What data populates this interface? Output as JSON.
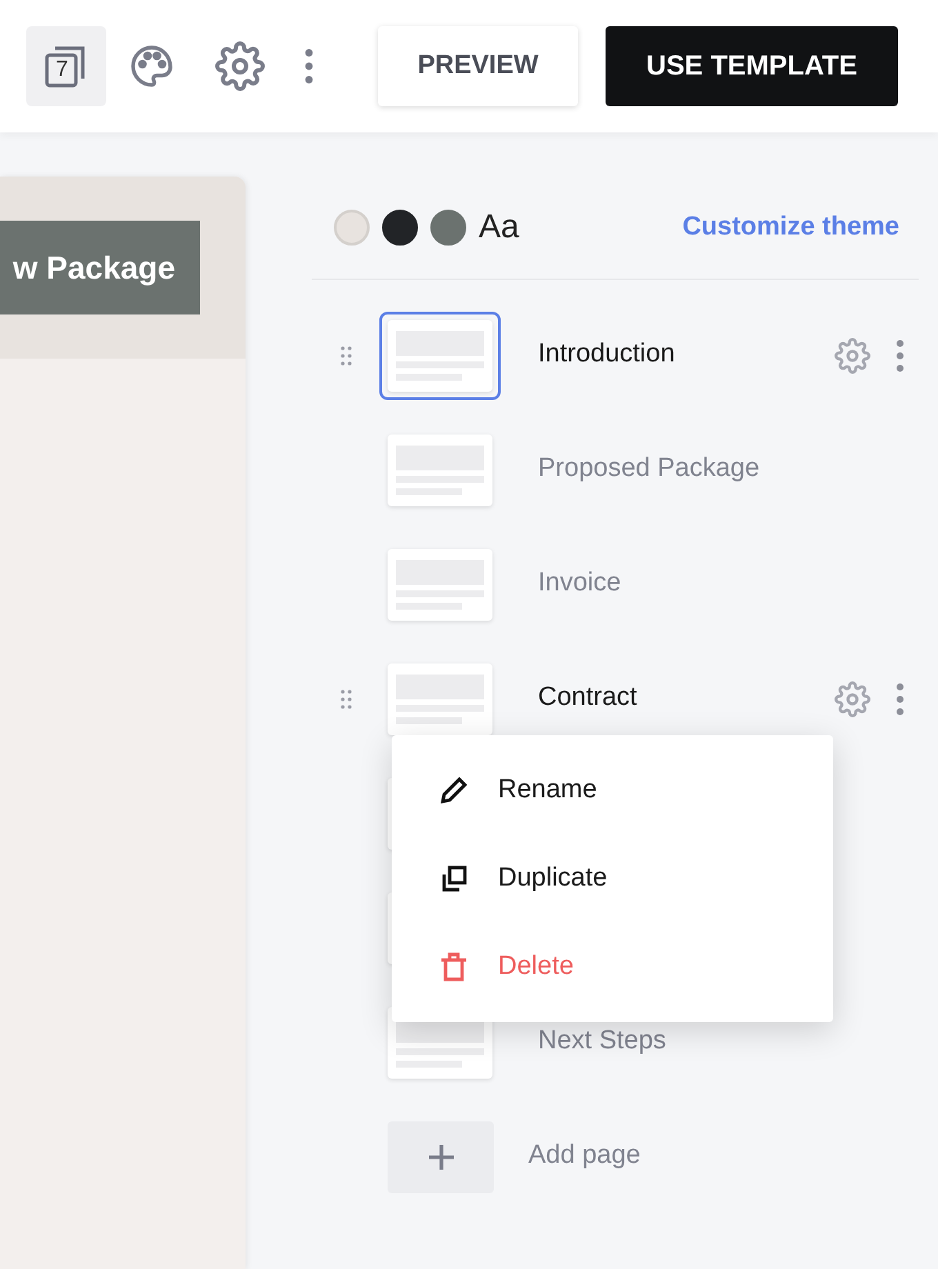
{
  "toolbar": {
    "page_count": "7",
    "preview": "PREVIEW",
    "use_template": "USE TEMPLATE"
  },
  "canvas": {
    "button": "w Package"
  },
  "theme": {
    "swatches": [
      {
        "color": "#e8e3df"
      },
      {
        "color": "#222427"
      },
      {
        "color": "#6b726f"
      }
    ],
    "font_sample": "Aa",
    "customize": "Customize theme"
  },
  "pages": [
    {
      "title": "Introduction",
      "selected": true,
      "active": true
    },
    {
      "title": "Proposed Package",
      "selected": false,
      "active": false
    },
    {
      "title": "Invoice",
      "selected": false,
      "active": false
    },
    {
      "title": "Contract",
      "selected": false,
      "active": true
    },
    {
      "selected": false,
      "active": false
    },
    {
      "selected": false,
      "active": false
    },
    {
      "title": "Next Steps",
      "selected": false,
      "active": false
    }
  ],
  "add_page": "Add page",
  "menu": [
    {
      "kind": "rename",
      "label": "Rename"
    },
    {
      "kind": "duplicate",
      "label": "Duplicate"
    },
    {
      "kind": "delete",
      "label": "Delete"
    }
  ]
}
